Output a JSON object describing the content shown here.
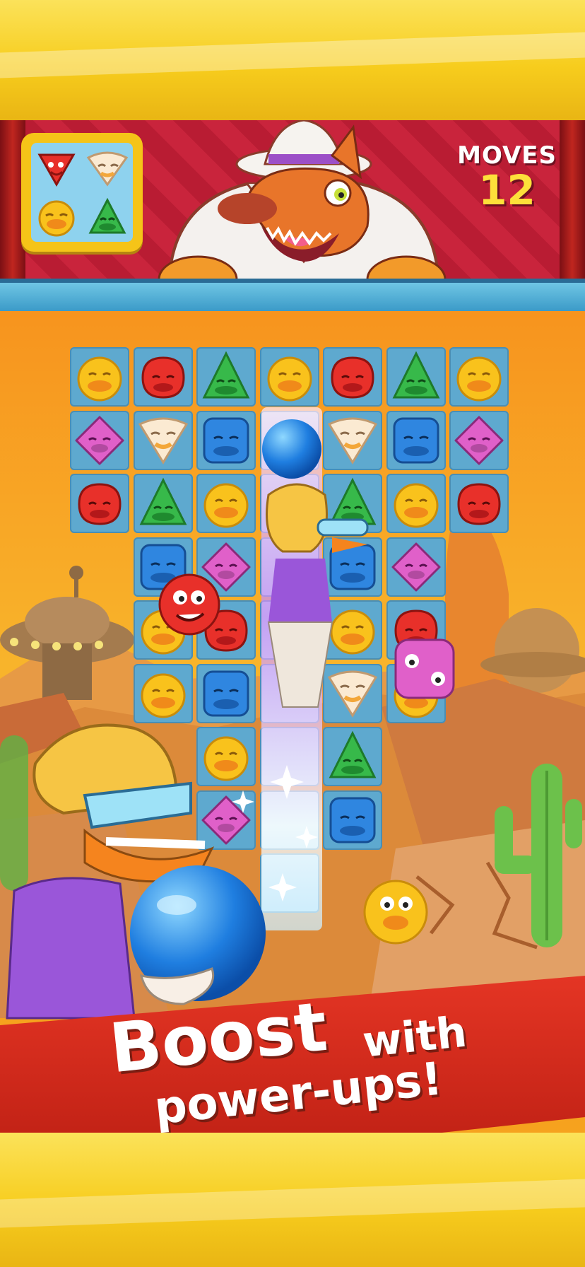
{
  "header": {
    "moves_label": "MOVES",
    "moves_value": "12",
    "goals": [
      "red-triangle-piece",
      "white-triangle-piece",
      "yellow-round-piece",
      "green-triangle-piece"
    ]
  },
  "board": {
    "rows": [
      [
        "yellow",
        "red",
        "green",
        "yellow",
        "red",
        "green",
        "yellow"
      ],
      [
        "pink",
        "white",
        "blue",
        "lightning",
        "white",
        "blue",
        "pink"
      ],
      [
        "red",
        "green",
        "yellow",
        "lightning",
        "green",
        "yellow",
        "red"
      ],
      [
        null,
        "blue",
        "pink",
        "lightning",
        "blue",
        "pink",
        null
      ],
      [
        null,
        "yellow",
        "red",
        "lightning",
        "yellow",
        "red",
        null
      ],
      [
        null,
        "yellow",
        "blue",
        "lightning",
        "white",
        "yellow",
        null
      ],
      [
        null,
        null,
        "yellow",
        "lightning",
        "green",
        null,
        null
      ],
      [
        null,
        null,
        "pink",
        "lightning",
        "blue",
        null,
        null
      ],
      [
        null,
        null,
        null,
        "lightning",
        null,
        null,
        null
      ]
    ]
  },
  "colors": {
    "yellow": "#f9c21c",
    "red": "#e8302a",
    "green": "#37b94a",
    "pink": "#e060c9",
    "blue": "#2f86e0",
    "white": "#fbead2",
    "banner": "#d4281b",
    "gold": "#f7cd1d"
  },
  "banner": {
    "line1_big": "Boost",
    "line1_small": "with",
    "line2": "power-ups!"
  }
}
